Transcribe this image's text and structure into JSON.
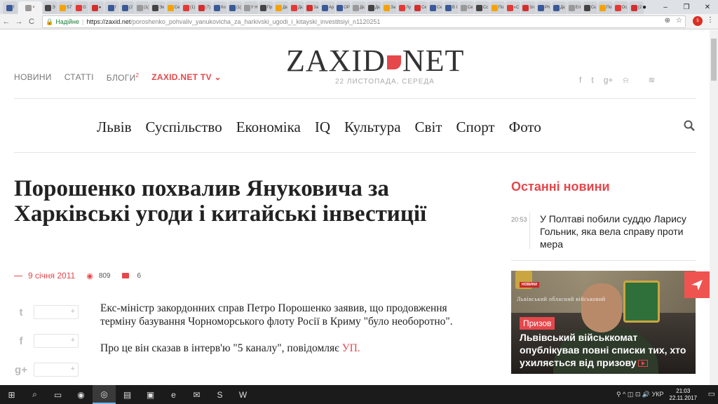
{
  "browser": {
    "active_tab_close": "×",
    "tab_titles": [
      "f",
      "",
      "Э",
      "S7",
      "G",
      "●",
      "f",
      "(2",
      "(1(",
      "Эк",
      "Се",
      "(1)",
      "(7)",
      "Ко",
      "(1(",
      "У Н",
      "Пр",
      "Дк",
      "Дє",
      "За",
      "Ар",
      "ОР",
      "Дє",
      "Дє",
      "За",
      "Лу",
      "Ск",
      "Ск",
      "В І",
      "Се",
      "Сс",
      "По",
      "«С",
      "Зл",
      "Рh",
      "Дє",
      "Егі",
      "Сє",
      "По",
      "Ос",
      "(2"
    ],
    "window_controls": {
      "user": "●",
      "minimize": "–",
      "restore": "❐",
      "close": "✕"
    },
    "nav": {
      "back": "←",
      "forward": "→",
      "reload": "C"
    },
    "secure_label": "Надійне",
    "url_scheme_host": "https://zaxid.net",
    "url_path": "/poroshenko_pohvaliv_yanukovicha_za_harkivski_ugodi_i_kitayski_investitsiyi_n1120251",
    "zoom_icon": "⊕",
    "star_icon": "☆",
    "ext_badge": "5",
    "menu_icon": "⋮"
  },
  "header": {
    "nav": [
      {
        "label": "НОВИНИ"
      },
      {
        "label": "СТАТТІ"
      },
      {
        "label": "БЛОГИ",
        "sup": "2"
      },
      {
        "label": "ZAXID.NET TV ⌄"
      }
    ],
    "logo_left": "ZAXID",
    "logo_right": "NET",
    "date": "22 ЛИСТОПАДА, СЕРЕДА",
    "social": [
      "f",
      "t",
      "g+",
      "⍾",
      "",
      "≋"
    ]
  },
  "main_nav": [
    "Львів",
    "Суспільство",
    "Економіка",
    "IQ",
    "Культура",
    "Світ",
    "Спорт",
    "Фото"
  ],
  "article": {
    "headline": "Порошенко похвалив Януковича за Харківські угоди і китайські інвестиції",
    "date": "9 січня 2011",
    "views": "809",
    "comments": "6",
    "share": [
      {
        "icon": "t"
      },
      {
        "icon": "f"
      },
      {
        "icon": "g+"
      }
    ],
    "share_plus": "+",
    "paragraph1": "Екс-міністр закордонних справ Петро Порошенко заявив, що продовження терміну базування Чорноморського флоту Росії в Криму \"було необоротно\".",
    "paragraph2_prefix": "Про це він сказав в інтерв'ю \"5 каналу\", повідомляє ",
    "paragraph2_source": "УП."
  },
  "sidebar": {
    "title": "Останні новини",
    "news": [
      {
        "time": "20:53",
        "text": "У Полтаві побили суддю Ларису Гольник, яка вела справу проти мера"
      }
    ],
    "feature": {
      "logo_text": "НОВИНИ",
      "wall_text": "Львівський обласний військовий",
      "tag": "Призов",
      "caption": "Львівський військкомат опублікував повні списки тих, хто ухиляється від призову"
    }
  },
  "taskbar": {
    "items": [
      "⊞",
      "⌕",
      "▭",
      "◉",
      "◎",
      "▤",
      "▣",
      "e",
      "✉",
      "S",
      "W"
    ],
    "tray": "⚲  ^  ◫  ⊡  🔊  УКР",
    "time": "21:03",
    "date": "22.11.2017",
    "notif": "▭"
  },
  "colors": {
    "accent": "#e5474b"
  }
}
